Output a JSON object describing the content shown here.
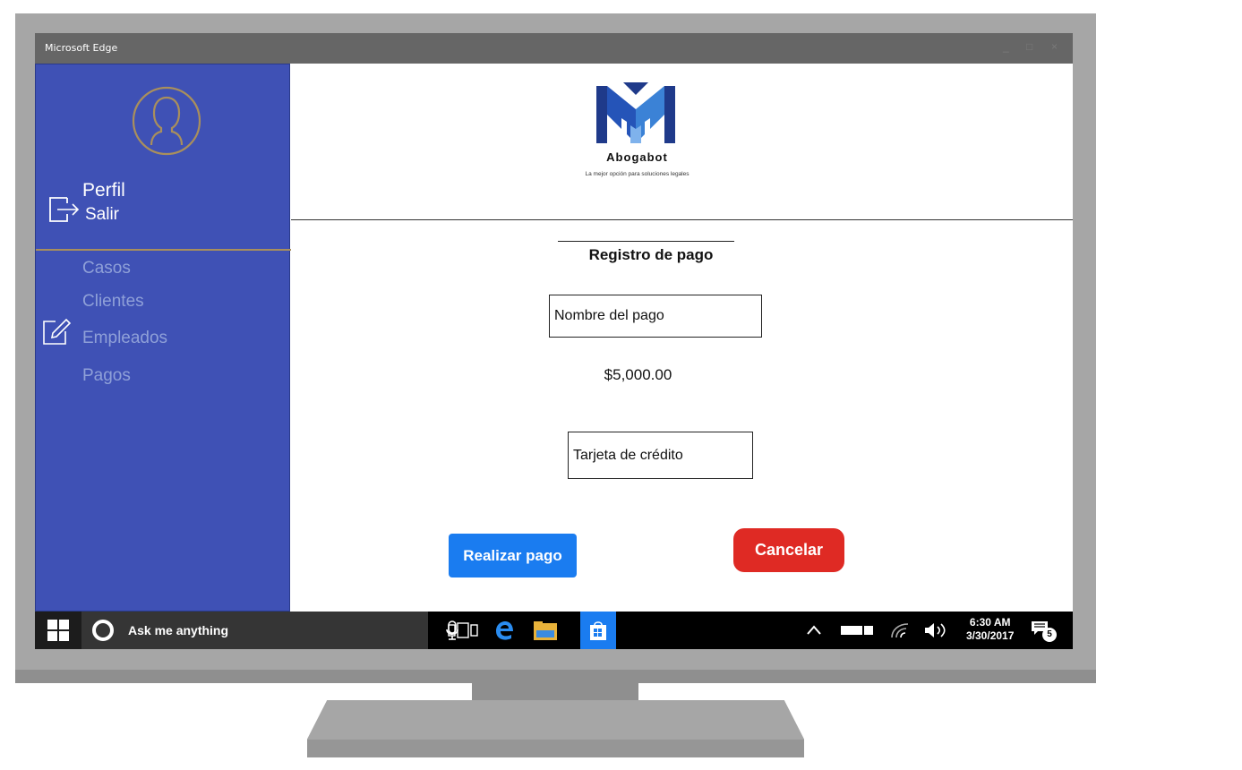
{
  "window": {
    "title": "Microsoft Edge",
    "controls": {
      "minimize": "_",
      "maximize": "□",
      "close": "×"
    }
  },
  "sidebar": {
    "profile_label": "Perfil",
    "logout_label": "Salir",
    "avatar_icon": "user-avatar-icon",
    "logout_icon": "exit-icon",
    "edit_icon": "edit-icon",
    "items": [
      {
        "label": "Casos"
      },
      {
        "label": "Clientes"
      },
      {
        "label": "Empleados"
      },
      {
        "label": "Pagos"
      }
    ],
    "colors": {
      "background": "#3f51b5",
      "accent": "#a98f5c",
      "item_text": "#8fa0d8"
    }
  },
  "header": {
    "brand": "Abogabot",
    "tagline": "La mejor opción para soluciones legales"
  },
  "form": {
    "title": "Registro de pago",
    "payment_name": "Nombre del pago",
    "amount": "$5,000.00",
    "payment_method": "Tarjeta de crédito",
    "submit_label": "Realizar pago",
    "cancel_label": "Cancelar",
    "colors": {
      "primary": "#1a7cf0",
      "danger": "#df2a24"
    }
  },
  "taskbar": {
    "search_placeholder": "Ask me anything",
    "time": "6:30 AM",
    "date": "3/30/2017",
    "notification_count": "5",
    "icons": [
      "windows-start-icon",
      "cortana-icon",
      "microphone-icon",
      "task-view-icon",
      "edge-icon",
      "file-explorer-icon",
      "store-icon",
      "chevron-up-icon",
      "battery-icon",
      "wifi-icon",
      "volume-icon",
      "notification-icon"
    ]
  }
}
